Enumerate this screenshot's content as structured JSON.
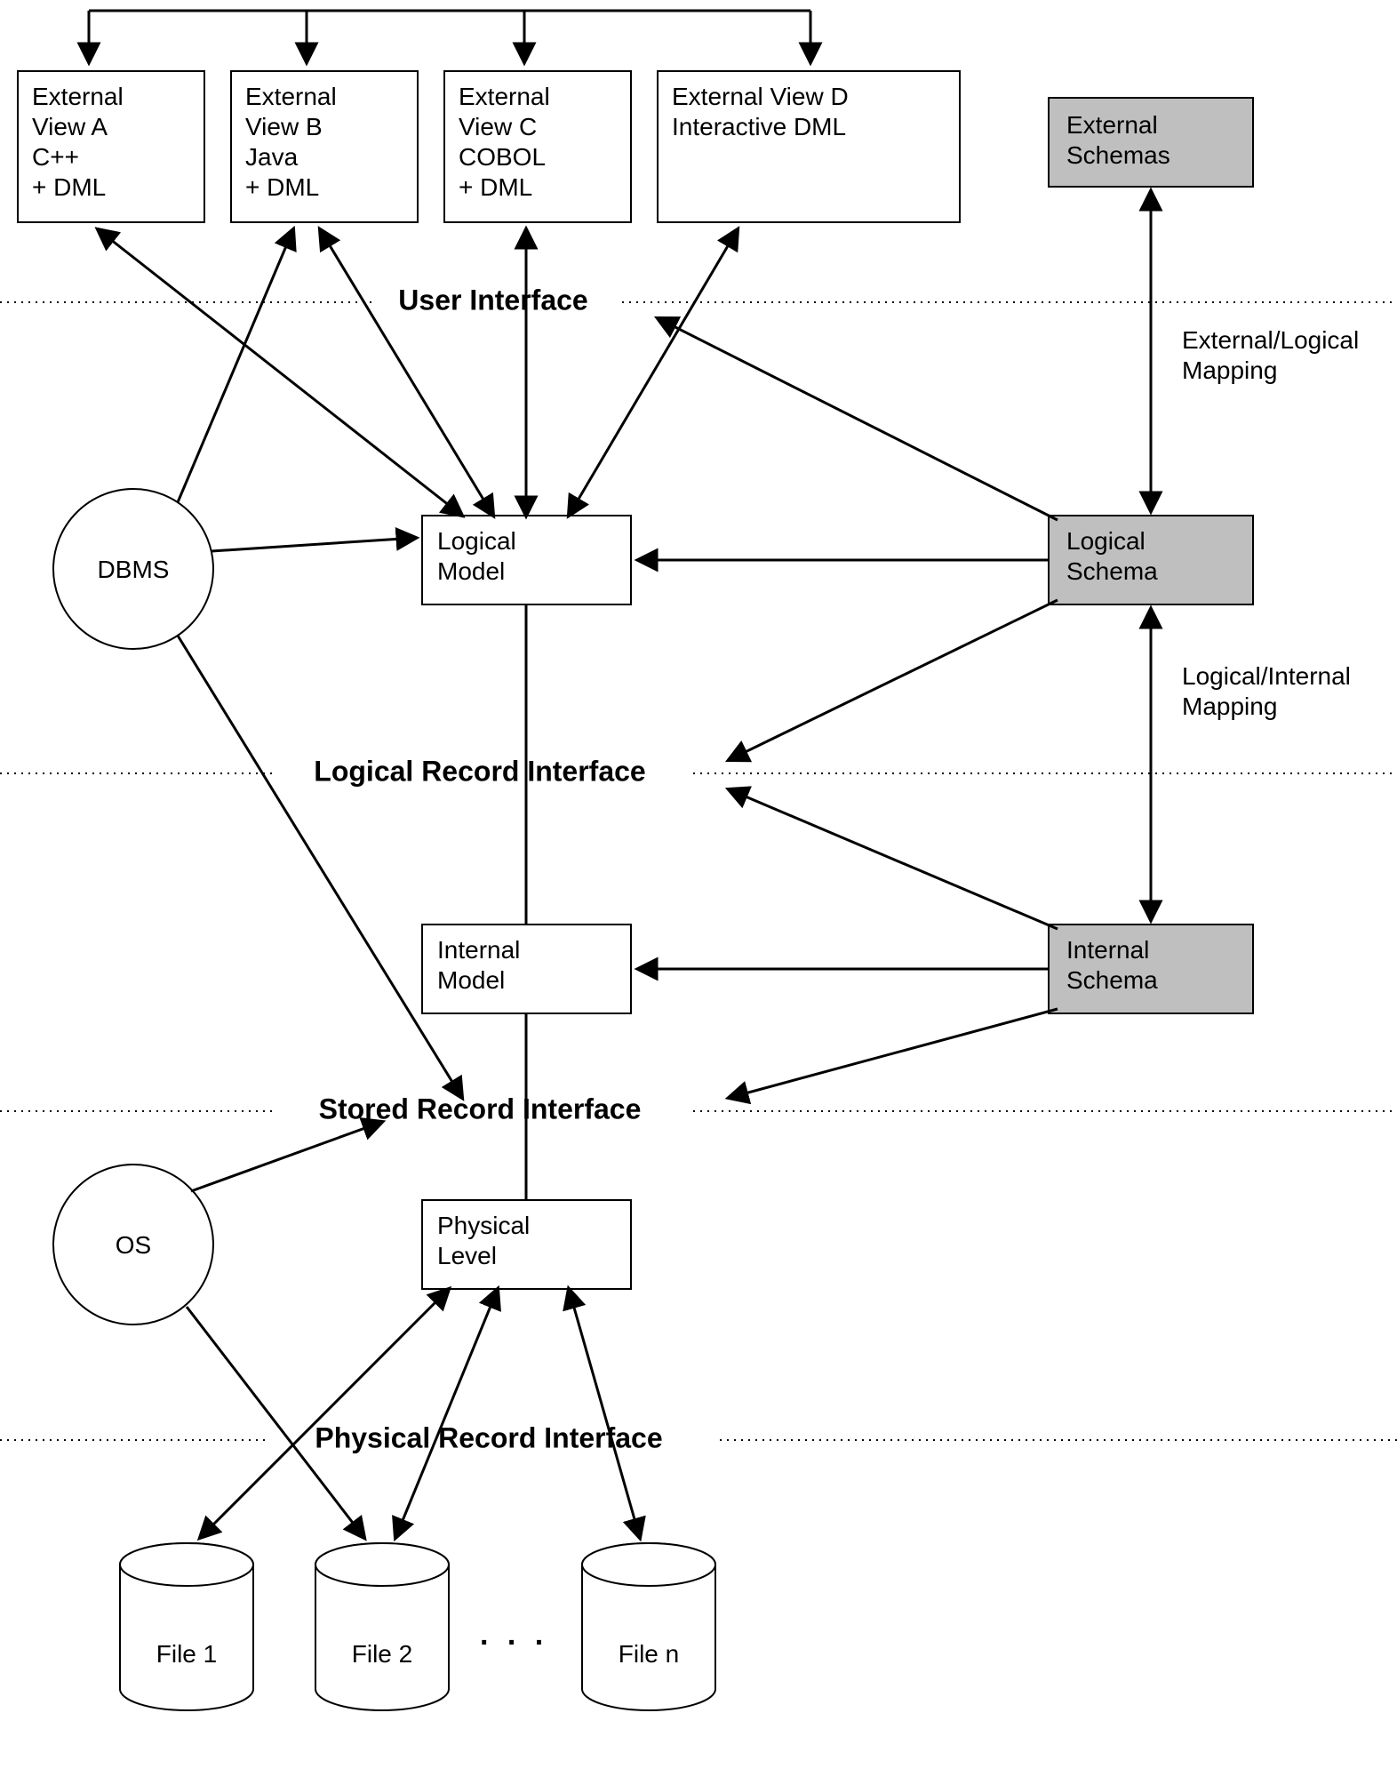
{
  "views": {
    "a": {
      "line1": "External",
      "line2": "View A",
      "line3": "C++",
      "line4": "+ DML"
    },
    "b": {
      "line1": "External",
      "line2": "View B",
      "line3": "Java",
      "line4": "+ DML"
    },
    "c": {
      "line1": "External",
      "line2": "View C",
      "line3": "COBOL",
      "line4": "+ DML"
    },
    "d": {
      "line1": "External View D",
      "line2": "Interactive DML"
    }
  },
  "schemas": {
    "external": {
      "line1": "External",
      "line2": "Schemas"
    },
    "logical": {
      "line1": "Logical",
      "line2": "Schema"
    },
    "internal": {
      "line1": "Internal",
      "line2": "Schema"
    }
  },
  "models": {
    "logical": {
      "line1": "Logical",
      "line2": "Model"
    },
    "internal": {
      "line1": "Internal",
      "line2": "Model"
    },
    "physical": {
      "line1": "Physical",
      "line2": "Level"
    }
  },
  "circles": {
    "dbms": "DBMS",
    "os": "OS"
  },
  "interfaces": {
    "user": "User Interface",
    "logical": "Logical Record Interface",
    "stored": "Stored Record Interface",
    "physical": "Physical Record Interface"
  },
  "mappings": {
    "ext_logical": {
      "line1": "External/Logical",
      "line2": "Mapping"
    },
    "logical_internal": {
      "line1": "Logical/Internal",
      "line2": "Mapping"
    }
  },
  "files": {
    "f1": "File 1",
    "f2": "File 2",
    "fn": "File n",
    "ellipsis": ". . ."
  }
}
